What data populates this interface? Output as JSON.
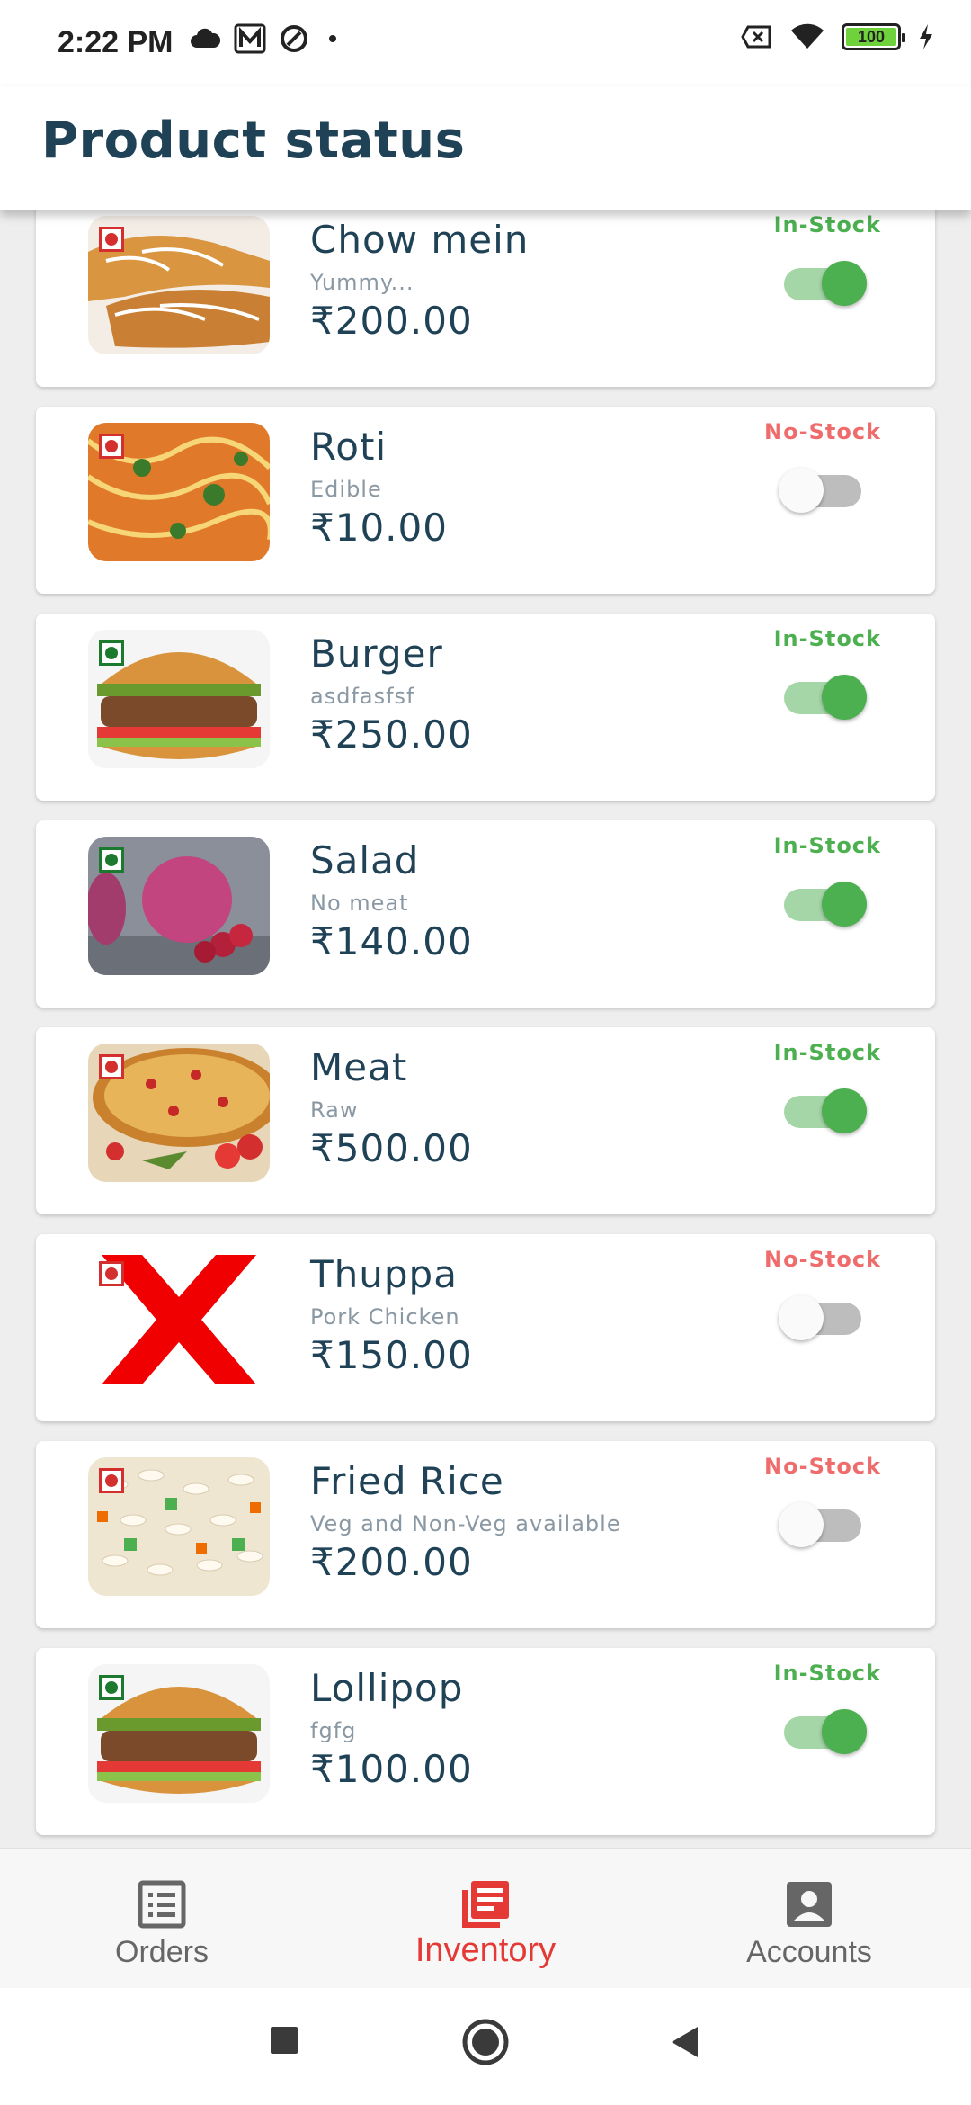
{
  "status_bar": {
    "time": "2:22 PM",
    "battery": "100",
    "icons_left": [
      "cloud-icon",
      "m-icon",
      "no-disturb-icon",
      "dot-icon"
    ],
    "icons_right": [
      "sim-off-icon",
      "wifi-icon",
      "battery-icon",
      "charging-icon"
    ]
  },
  "app_bar": {
    "title": "Product status"
  },
  "colors": {
    "primary_text": "#1f4257",
    "in_stock": "#4caf50",
    "no_stock": "#ef6c6c",
    "accent": "#e53935"
  },
  "products": [
    {
      "name": "Chow mein",
      "description": "Yummy...",
      "price": "₹200.00",
      "status": "In-Stock",
      "in_stock": true,
      "veg": false,
      "image": "pastry-image"
    },
    {
      "name": "Roti",
      "description": "Edible",
      "price": "₹10.00",
      "status": "No-Stock",
      "in_stock": false,
      "veg": false,
      "image": "noodles-image"
    },
    {
      "name": "Burger",
      "description": "asdfasfsf",
      "price": "₹250.00",
      "status": "In-Stock",
      "in_stock": true,
      "veg": true,
      "image": "burger-image"
    },
    {
      "name": "Salad",
      "description": "No meat",
      "price": "₹140.00",
      "status": "In-Stock",
      "in_stock": true,
      "veg": true,
      "image": "macaron-image"
    },
    {
      "name": "Meat",
      "description": "Raw",
      "price": "₹500.00",
      "status": "In-Stock",
      "in_stock": true,
      "veg": false,
      "image": "pizza-image"
    },
    {
      "name": "Thuppa",
      "description": "Pork Chicken",
      "price": "₹150.00",
      "status": "No-Stock",
      "in_stock": false,
      "veg": false,
      "image": "red-x-image"
    },
    {
      "name": "Fried Rice",
      "description": "Veg and Non-Veg available",
      "price": "₹200.00",
      "status": "No-Stock",
      "in_stock": false,
      "veg": false,
      "image": "fried-rice-image"
    },
    {
      "name": "Lollipop",
      "description": "fgfg",
      "price": "₹100.00",
      "status": "In-Stock",
      "in_stock": true,
      "veg": true,
      "image": "burger-image"
    }
  ],
  "bottom_nav": {
    "items": [
      {
        "label": "Orders",
        "icon": "list-icon",
        "active": false
      },
      {
        "label": "Inventory",
        "icon": "inventory-icon",
        "active": true
      },
      {
        "label": "Accounts",
        "icon": "account-icon",
        "active": false
      }
    ]
  },
  "system_nav": [
    "recents-button",
    "home-button",
    "back-button"
  ]
}
